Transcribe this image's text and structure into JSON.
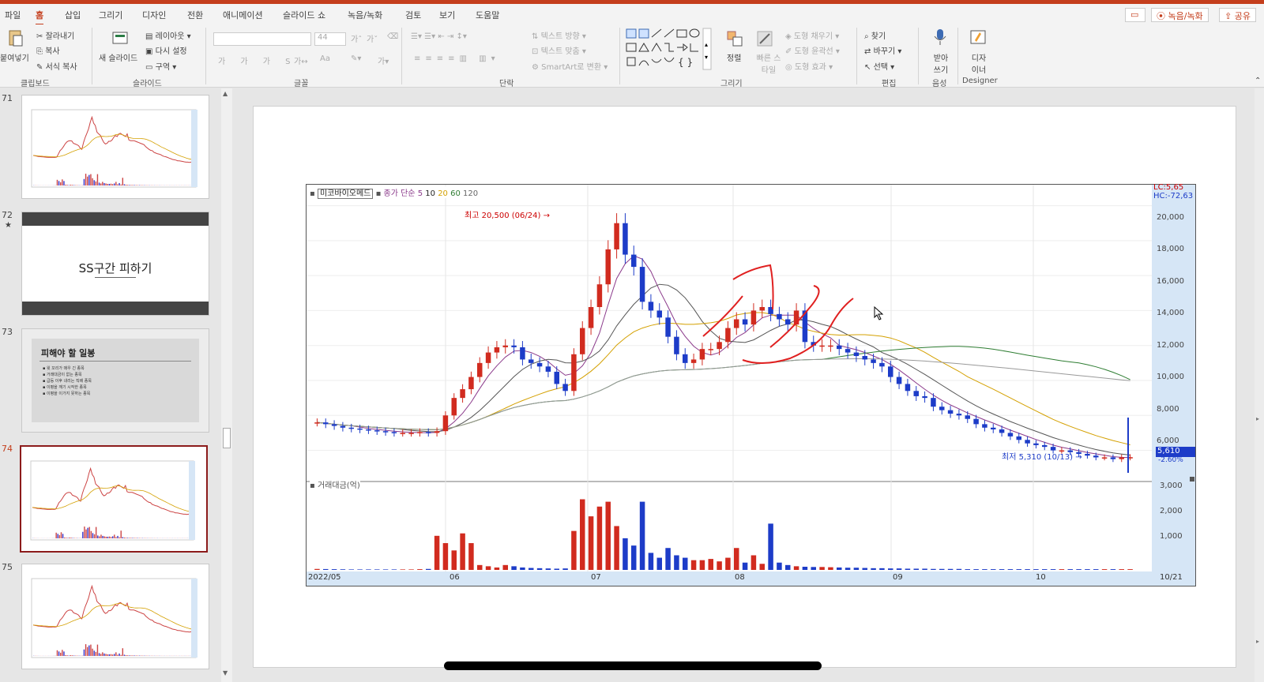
{
  "menu": {
    "tabs": [
      "파일",
      "홈",
      "삽입",
      "그리기",
      "디자인",
      "전환",
      "애니메이션",
      "슬라이드 쇼",
      "녹음/녹화",
      "검토",
      "보기",
      "도움말"
    ],
    "record_btn": "⦿ 녹음/녹화",
    "share_btn": "공유"
  },
  "ribbon": {
    "clipboard": {
      "paste": "붙여넣기",
      "cut": "잘라내기",
      "copy": "복사",
      "format": "서식 복사",
      "label": "클립보드"
    },
    "slides": {
      "new": "새 슬라이드",
      "layout": "레이아웃",
      "reset": "다시 설정",
      "section": "구역",
      "label": "슬라이드"
    },
    "font": {
      "label": "글꼴",
      "size": "44"
    },
    "paragraph": {
      "text_dir": "텍스트 방향",
      "align_text": "텍스트 맞춤",
      "smartart": "SmartArt로 변환",
      "label": "단락"
    },
    "drawing": {
      "arrange": "정렬",
      "quick_styles": "빠른 스타일",
      "fill": "도형 채우기",
      "outline": "도형 윤곽선",
      "effects": "도형 효과",
      "label": "그리기"
    },
    "editing": {
      "find": "찾기",
      "replace": "바꾸기",
      "select": "선택",
      "label": "편집"
    },
    "voice": {
      "dictate": "받아 쓰기",
      "label": "음성"
    },
    "designer": {
      "btn": "디자 이너",
      "label": "Designer"
    }
  },
  "thumbnails": [
    {
      "num": "71"
    },
    {
      "num": "72",
      "star": "★",
      "title": "SS구간 피하기"
    },
    {
      "num": "73",
      "title": "피해야 할 일봉",
      "bullets": [
        "▪ 윗 꼬리가 매우 긴 종목",
        "▪ 거래대금이 없는 종목",
        "▪ 급등 이후 내리는 직배 종목",
        "▪ 이평을 깨기 시작한 종목",
        "▪ 이평을 이가지 못하는 종목"
      ]
    },
    {
      "num": "74"
    },
    {
      "num": "75"
    }
  ],
  "chart": {
    "stock_name": "미코바이오메드",
    "ma_label": "종가 단순",
    "ma5": "5",
    "ma10": "10",
    "ma20": "20",
    "ma60": "60",
    "ma120": "120",
    "lc": "LC:5,65",
    "hc": "HC:-72,63",
    "high_label": "최고 20,500 (06/24)",
    "low_label": "최저 5,310 (10/13)",
    "price_now": "5,610",
    "change": "-2.60%",
    "price_ticks": [
      "20,000",
      "18,000",
      "16,000",
      "14,000",
      "12,000",
      "10,000",
      "8,000",
      "6,000"
    ],
    "vol_title": "거래대금(억)",
    "vol_ticks": [
      "3,000",
      "2,000",
      "1,000"
    ],
    "dates": [
      "2022/05",
      "06",
      "07",
      "08",
      "09",
      "10"
    ],
    "date_end": "10/21"
  },
  "chart_data": {
    "type": "candlestick",
    "title": "미코바이오메드",
    "ylim": [
      4400,
      21200
    ],
    "price_ticks": [
      20000,
      18000,
      16000,
      14000,
      12000,
      10000,
      8000,
      6000
    ],
    "high": {
      "value": 20500,
      "date": "06/24"
    },
    "low": {
      "value": 5310,
      "date": "10/13"
    },
    "closes": [
      7600,
      7500,
      7400,
      7300,
      7250,
      7200,
      7150,
      7100,
      7050,
      7000,
      7000,
      7000,
      7050,
      7000,
      7100,
      8000,
      9000,
      9500,
      10200,
      11000,
      11600,
      11900,
      12000,
      11900,
      11200,
      11000,
      10800,
      10500,
      9800,
      9400,
      11500,
      13000,
      14200,
      15500,
      17500,
      19000,
      17200,
      16500,
      14500,
      14000,
      13600,
      12500,
      11500,
      11000,
      11200,
      11800,
      11800,
      12200,
      13000,
      13500,
      13200,
      14000,
      14200,
      13800,
      13500,
      13200,
      14000,
      12200,
      12000,
      12000,
      12000,
      11800,
      11600,
      11400,
      11200,
      11000,
      10800,
      10200,
      9800,
      9400,
      9100,
      9000,
      8500,
      8300,
      8100,
      8000,
      7800,
      7500,
      7300,
      7200,
      7000,
      6800,
      6600,
      6400,
      6300,
      6200,
      6000,
      6000,
      5900,
      5800,
      5700,
      5600,
      5600,
      5500,
      5600,
      5610
    ]
  },
  "volume_data": {
    "type": "bar",
    "ylim": [
      0,
      3500
    ],
    "values": [
      40,
      35,
      30,
      25,
      20,
      20,
      20,
      20,
      20,
      20,
      20,
      20,
      30,
      40,
      1400,
      1100,
      800,
      1500,
      1100,
      200,
      150,
      100,
      200,
      150,
      100,
      80,
      70,
      60,
      50,
      60,
      1600,
      2900,
      2200,
      2600,
      2800,
      1800,
      1300,
      1000,
      2800,
      700,
      500,
      900,
      600,
      500,
      400,
      400,
      450,
      350,
      500,
      900,
      300,
      600,
      250,
      1900,
      300,
      200,
      150,
      130,
      120,
      120,
      110,
      100,
      90,
      90,
      80,
      70,
      70,
      60,
      60,
      50,
      50,
      50,
      40,
      40,
      40,
      40,
      30,
      30,
      30,
      30,
      30,
      30,
      30,
      30,
      30,
      30,
      30,
      30,
      30,
      30,
      30,
      30,
      30,
      30,
      30,
      30
    ]
  }
}
